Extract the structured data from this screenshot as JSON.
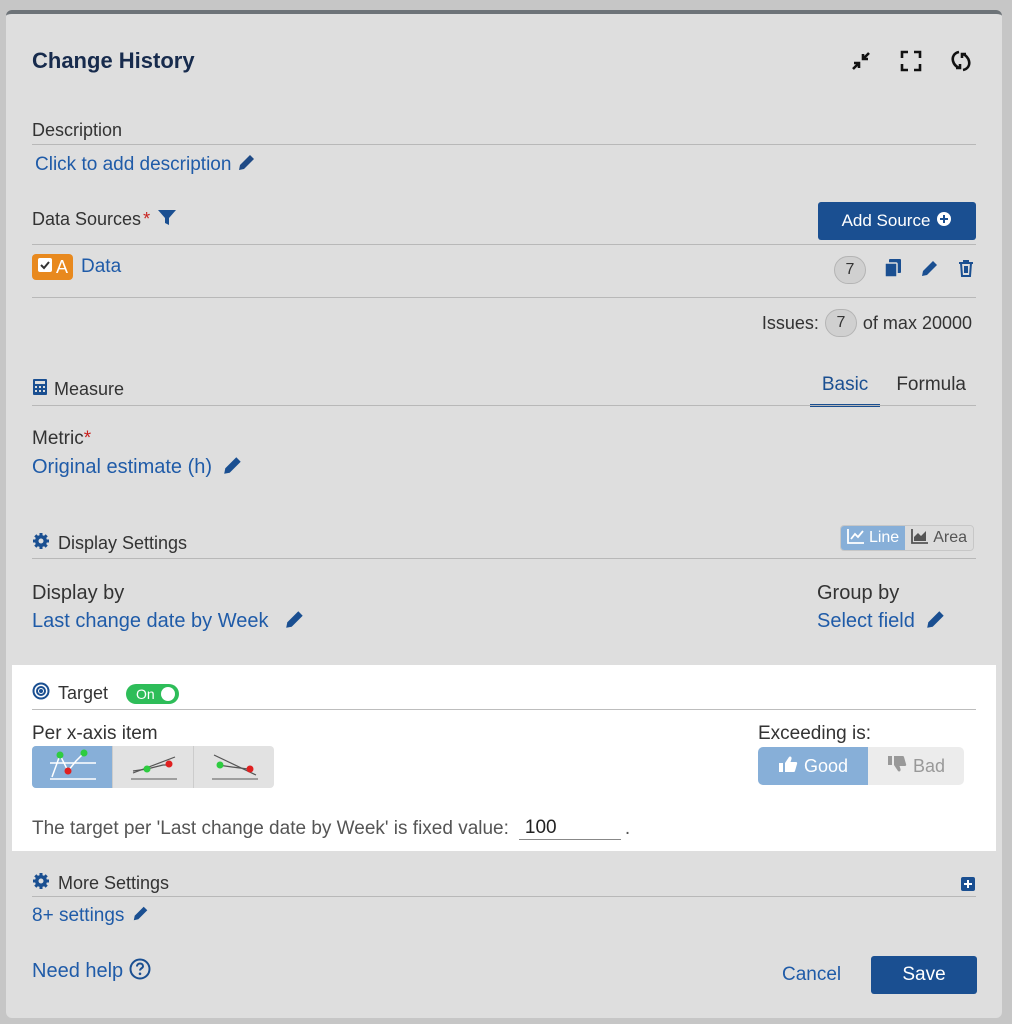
{
  "header": {
    "title": "Change History"
  },
  "description": {
    "label": "Description",
    "link": "Click to add description"
  },
  "data_sources": {
    "label": "Data Sources",
    "required_mark": "*",
    "add_button": "Add Source",
    "item": {
      "badge_letter": "A",
      "name": "Data",
      "count": "7"
    },
    "issues_label": "Issues:",
    "issues_count": "7",
    "issues_max": "of max 20000"
  },
  "measure": {
    "label": "Measure",
    "tabs": [
      "Basic",
      "Formula"
    ],
    "metric_label": "Metric",
    "required_mark": "*",
    "metric_value": "Original estimate (h)"
  },
  "display": {
    "label": "Display Settings",
    "chart_types": [
      "Line",
      "Area"
    ],
    "display_by_label": "Display by",
    "display_by_value": "Last change date by Week",
    "group_by_label": "Group by",
    "group_by_value": "Select field"
  },
  "target": {
    "label": "Target",
    "toggle": "On",
    "per_label": "Per x-axis item",
    "exceeding_label": "Exceeding is:",
    "good": "Good",
    "bad": "Bad",
    "sentence": "The target per 'Last change date by Week' is fixed value:",
    "value": "100",
    "trailing": "."
  },
  "more": {
    "label": "More Settings",
    "link": "8+ settings"
  },
  "footer": {
    "help": "Need help",
    "cancel": "Cancel",
    "save": "Save"
  },
  "colors": {
    "primary": "#1a4f91",
    "link": "#1f5ba8",
    "toggle_on": "#2ebd59",
    "badge": "#e8891e"
  }
}
